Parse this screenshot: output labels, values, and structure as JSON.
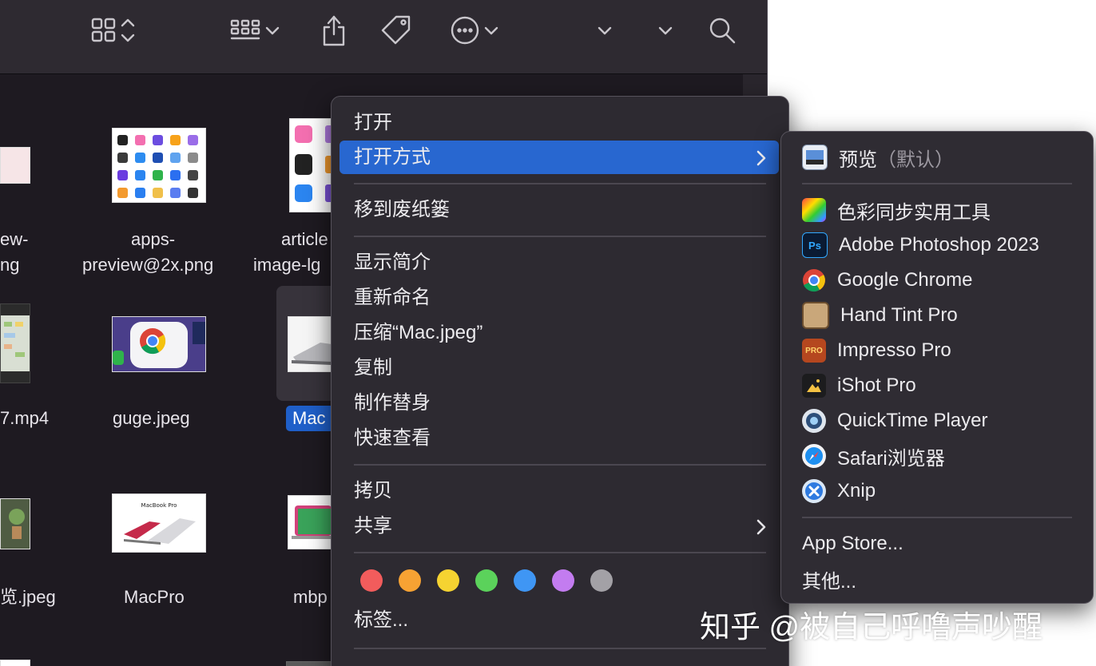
{
  "toolbar": {
    "icons": [
      "grid-view-icon",
      "group-by-icon",
      "share-icon",
      "tag-icon",
      "more-actions-icon",
      "search-icon"
    ]
  },
  "files": [
    {
      "name": "ew-",
      "name2": "ng"
    },
    {
      "name": "apps-",
      "name2": "preview@2x.png"
    },
    {
      "name": "article",
      "name2": "image-lg"
    },
    {
      "name": "7.mp4"
    },
    {
      "name": "guge.jpeg"
    },
    {
      "name": "Mac"
    },
    {
      "name": "览.jpeg"
    },
    {
      "name": "MacPro"
    },
    {
      "name": "mbp"
    }
  ],
  "menu": {
    "open": "打开",
    "open_with": "打开方式",
    "move_to_trash": "移到废纸篓",
    "get_info": "显示简介",
    "rename": "重新命名",
    "compress": "压缩“Mac.jpeg”",
    "duplicate": "复制",
    "make_alias": "制作替身",
    "quick_look": "快速查看",
    "copy": "拷贝",
    "share": "共享",
    "tags": "标签...",
    "tag_colors": [
      "#f25c5c",
      "#f7a233",
      "#f5d331",
      "#5bd25b",
      "#3f96f4",
      "#c37cf0",
      "#a3a1a6"
    ]
  },
  "submenu": {
    "default_app": "预览",
    "default_hint": "（默认）",
    "apps": [
      {
        "label": "色彩同步实用工具",
        "icon": "colorsync-icon"
      },
      {
        "label": "Adobe Photoshop 2023",
        "icon": "photoshop-icon"
      },
      {
        "label": "Google Chrome",
        "icon": "chrome-icon"
      },
      {
        "label": "Hand Tint Pro",
        "icon": "hand-tint-icon"
      },
      {
        "label": "Impresso Pro",
        "icon": "impresso-icon"
      },
      {
        "label": "iShot Pro",
        "icon": "ishot-icon"
      },
      {
        "label": "QuickTime Player",
        "icon": "quicktime-icon"
      },
      {
        "label": "Safari浏览器",
        "icon": "safari-icon"
      },
      {
        "label": "Xnip",
        "icon": "xnip-icon"
      }
    ],
    "app_store": "App Store...",
    "other": "其他..."
  },
  "watermark": "知乎 @被自己呼噜声吵醒"
}
